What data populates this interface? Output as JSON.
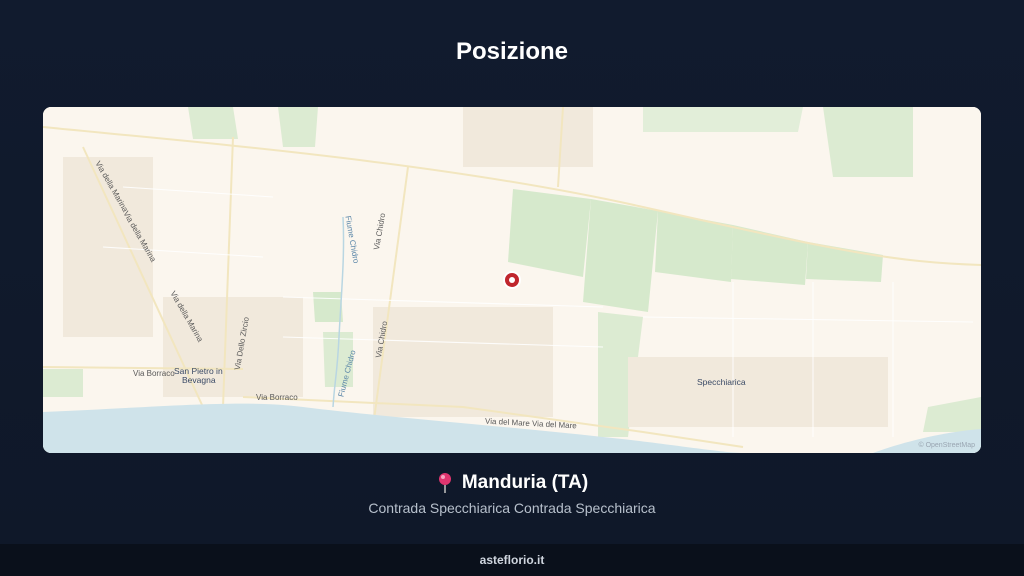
{
  "header": {
    "title": "Posizione"
  },
  "map": {
    "labels": {
      "san_pietro_line1": "San Pietro in",
      "san_pietro_line2": "Bevagna",
      "specchiarica": "Specchiarica",
      "via_borraco_1": "Via Borraco",
      "via_borraco_2": "Via Borraco",
      "via_del_mare": "Via del Mare Via del Mare",
      "via_chidro_1": "Via Chidro",
      "via_chidro_2": "Via Chidro",
      "fiume_chidro_1": "Fiume Chidro",
      "fiume_chidro_2": "Fiume Chidro",
      "via_della_marina_1": "Via della Marina",
      "via_della_marina_2": "Via della Marina",
      "via_della_marina_3": "Via della Marina",
      "via_dello_zircio": "Via Dello Zircio"
    },
    "attribution": "© OpenStreetMap",
    "marker_color": "#c0262d"
  },
  "location": {
    "pin_icon": "map-pin-icon",
    "city": "Manduria (TA)",
    "address": "Contrada Specchiarica Contrada Specchiarica"
  },
  "footer": {
    "site": "asteflorio.it"
  },
  "colors": {
    "background": "#111b2e",
    "map_land": "#fbf6ee",
    "map_green": "#d9ecd0",
    "map_sea": "#cfe3ea",
    "footer": "#0a101b"
  }
}
